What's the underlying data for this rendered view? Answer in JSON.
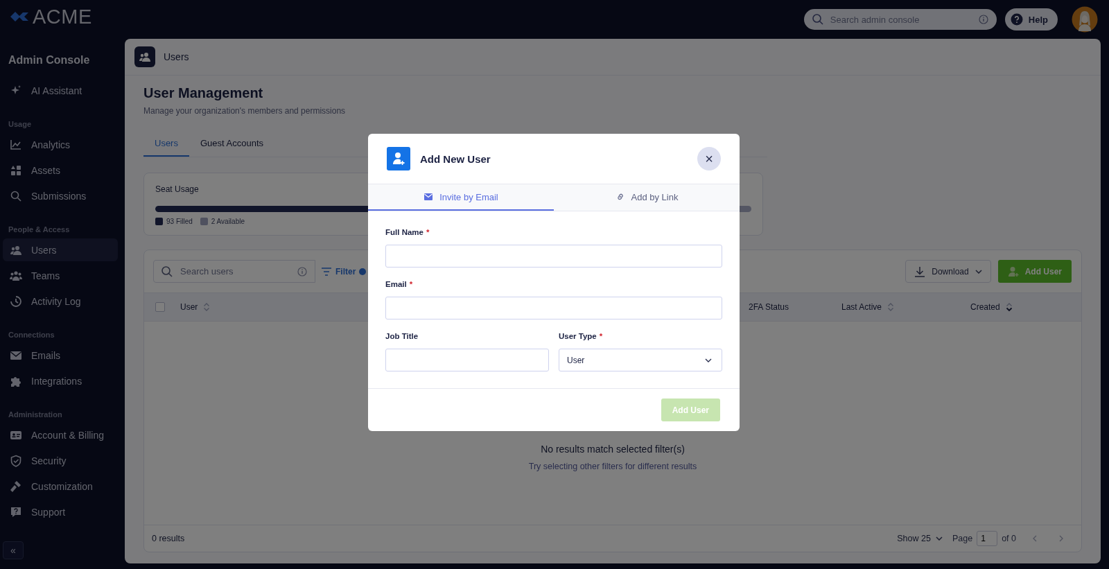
{
  "logo": {
    "text": "ACME"
  },
  "sidebar": {
    "title": "Admin Console",
    "groups": [
      {
        "items": [
          {
            "label": "AI Assistant",
            "selected": false
          }
        ]
      },
      {
        "heading": "Usage",
        "items": [
          {
            "label": "Analytics",
            "selected": false
          },
          {
            "label": "Assets",
            "selected": false
          },
          {
            "label": "Submissions",
            "selected": false
          }
        ]
      },
      {
        "heading": "People & Access",
        "items": [
          {
            "label": "Users",
            "selected": true
          },
          {
            "label": "Teams",
            "selected": false
          },
          {
            "label": "Activity Log",
            "selected": false
          }
        ]
      },
      {
        "heading": "Connections",
        "items": [
          {
            "label": "Emails",
            "selected": false
          },
          {
            "label": "Integrations",
            "selected": false
          }
        ]
      },
      {
        "heading": "Administration",
        "items": [
          {
            "label": "Account & Billing",
            "selected": false
          },
          {
            "label": "Security",
            "selected": false
          },
          {
            "label": "Customization",
            "selected": false
          },
          {
            "label": "Support",
            "selected": false
          }
        ]
      }
    ],
    "collapse_button": "«"
  },
  "topbar": {
    "search": {
      "placeholder": "Search admin console"
    },
    "help": "Help"
  },
  "page": {
    "breadcrumb": "Users",
    "title": "User Management",
    "subtitle": "Manage your organization's members and permissions",
    "tabs": [
      {
        "label": "Users",
        "selected": true
      },
      {
        "label": "Guest Accounts",
        "selected": false
      }
    ]
  },
  "seat_usage": {
    "title": "Seat Usage",
    "level": 0.98,
    "legend": [
      {
        "label": "93 Filled",
        "kind": "filled"
      },
      {
        "label": "2 Available",
        "kind": "available"
      }
    ]
  },
  "users_table": {
    "search": {
      "placeholder": "Search users"
    },
    "filter": "Filter",
    "download": "Download",
    "add_user": "Add User",
    "header_checkbox": {
      "checked": false
    },
    "columns": [
      {
        "label": "User",
        "sortable": true,
        "sorted_descending": false
      },
      {
        "label": "2FA Status",
        "sortable": false
      },
      {
        "label": "Last Active",
        "sortable": true,
        "sorted_descending": false
      },
      {
        "label": "Created",
        "sortable": true,
        "sorted_descending": true
      }
    ],
    "empty_title": "No results match selected filter(s)",
    "empty_hint": "Try selecting other filters for different results",
    "result_count": "0 results",
    "pagination": {
      "show": "Show 25",
      "page_label": "Page",
      "page": "1",
      "of": "of 0"
    }
  },
  "modal": {
    "title": "Add New User",
    "close": "×",
    "required_mark": "*",
    "tabs": [
      {
        "label": "Invite by Email",
        "selected": true
      },
      {
        "label": "Add by Link",
        "selected": false
      }
    ],
    "rows": [
      [
        {
          "label": "Full Name",
          "required": true,
          "kind": "text"
        }
      ],
      [
        {
          "label": "Email",
          "required": true,
          "kind": "text"
        }
      ],
      [
        {
          "label": "Job Title",
          "required": false,
          "kind": "text"
        },
        {
          "label": "User Type",
          "required": true,
          "kind": "select",
          "value": "User"
        }
      ]
    ],
    "submit": {
      "label": "Add User",
      "disabled": true
    }
  }
}
